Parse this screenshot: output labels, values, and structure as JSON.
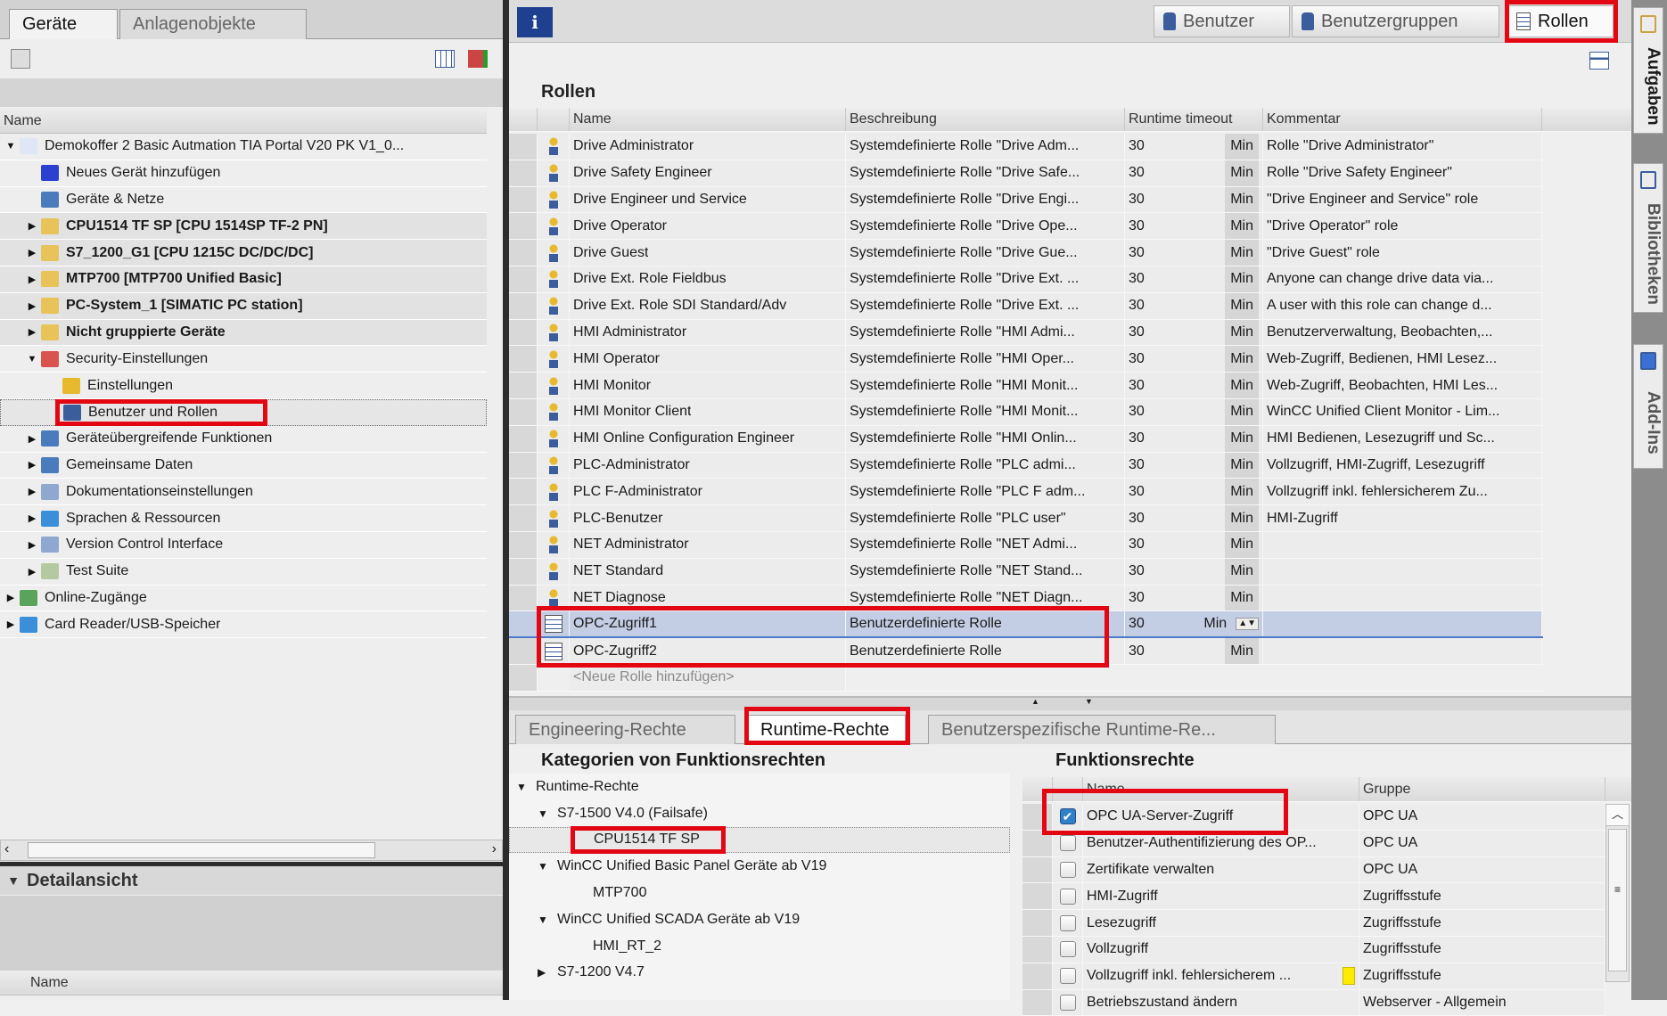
{
  "left": {
    "tabs": [
      "Geräte",
      "Anlagenobjekte"
    ],
    "column": "Name",
    "tree": [
      {
        "label": "Demokoffer 2 Basic Autmation TIA Portal V20 PK  V1_0...",
        "level": 0,
        "toggle": "down",
        "icon": "project-icon",
        "color": "#dfe6f5"
      },
      {
        "label": "Neues Gerät hinzufügen",
        "level": 1,
        "toggle": "",
        "icon": "add-device-icon",
        "color": "#2b3fd1"
      },
      {
        "label": "Geräte & Netze",
        "level": 1,
        "toggle": "",
        "icon": "network-icon",
        "color": "#4a7bbd"
      },
      {
        "label": "CPU1514 TF SP [CPU 1514SP TF-2 PN]",
        "level": 1,
        "toggle": "right",
        "icon": "plc-folder-icon",
        "color": "#e8c35a",
        "bold": true
      },
      {
        "label": "S7_1200_G1 [CPU 1215C DC/DC/DC]",
        "level": 1,
        "toggle": "right",
        "icon": "plc-folder-icon",
        "color": "#e8c35a",
        "bold": true
      },
      {
        "label": "MTP700 [MTP700 Unified Basic]",
        "level": 1,
        "toggle": "right",
        "icon": "hmi-folder-icon",
        "color": "#e8c35a",
        "bold": true
      },
      {
        "label": "PC-System_1 [SIMATIC PC station]",
        "level": 1,
        "toggle": "right",
        "icon": "pc-folder-icon",
        "color": "#e8c35a",
        "bold": true
      },
      {
        "label": "Nicht gruppierte Geräte",
        "level": 1,
        "toggle": "right",
        "icon": "ungrouped-folder-icon",
        "color": "#e8c35a",
        "bold": true
      },
      {
        "label": "Security-Einstellungen",
        "level": 1,
        "toggle": "down",
        "icon": "security-folder-icon",
        "color": "#d9534f"
      },
      {
        "label": "Einstellungen",
        "level": 2,
        "toggle": "",
        "icon": "settings-icon",
        "color": "#e7b92f"
      },
      {
        "label": "Benutzer und Rollen",
        "level": 2,
        "toggle": "",
        "icon": "users-icon",
        "color": "#3b5d9c",
        "selected": true
      },
      {
        "label": "Geräteübergreifende Funktionen",
        "level": 1,
        "toggle": "right",
        "icon": "cross-device-icon",
        "color": "#4a7bbd"
      },
      {
        "label": "Gemeinsame Daten",
        "level": 1,
        "toggle": "right",
        "icon": "common-data-icon",
        "color": "#4a7bbd"
      },
      {
        "label": "Dokumentationseinstellungen",
        "level": 1,
        "toggle": "right",
        "icon": "documentation-icon",
        "color": "#8fa8d0"
      },
      {
        "label": "Sprachen & Ressourcen",
        "level": 1,
        "toggle": "right",
        "icon": "languages-icon",
        "color": "#3a8fd8"
      },
      {
        "label": "Version Control Interface",
        "level": 1,
        "toggle": "right",
        "icon": "version-control-icon",
        "color": "#8fa8d0"
      },
      {
        "label": "Test Suite",
        "level": 1,
        "toggle": "right",
        "icon": "test-suite-icon",
        "color": "#b5c9a0"
      },
      {
        "label": "Online-Zugänge",
        "level": 0,
        "toggle": "right",
        "icon": "online-access-icon",
        "color": "#5aa35a"
      },
      {
        "label": "Card Reader/USB-Speicher",
        "level": 0,
        "toggle": "right",
        "icon": "card-reader-icon",
        "color": "#3a8fd8"
      }
    ],
    "detail_title": "Detailansicht",
    "detail_column": "Name"
  },
  "right": {
    "buttons": {
      "users": "Benutzer",
      "groups": "Benutzergruppen",
      "roles": "Rollen"
    },
    "title": "Rollen",
    "columns": [
      "Name",
      "Beschreibung",
      "Runtime timeout",
      "Kommentar"
    ],
    "roles": [
      {
        "name": "Drive Administrator",
        "desc": "Systemdefinierte Rolle \"Drive Adm...",
        "timeout": "30",
        "unit": "Min",
        "comment": "Rolle \"Drive Administrator\""
      },
      {
        "name": "Drive Safety Engineer",
        "desc": "Systemdefinierte Rolle \"Drive Safe...",
        "timeout": "30",
        "unit": "Min",
        "comment": "Rolle \"Drive Safety Engineer\""
      },
      {
        "name": "Drive Engineer und Service",
        "desc": "Systemdefinierte Rolle \"Drive Engi...",
        "timeout": "30",
        "unit": "Min",
        "comment": "\"Drive Engineer and Service\" role"
      },
      {
        "name": "Drive Operator",
        "desc": "Systemdefinierte Rolle \"Drive Ope...",
        "timeout": "30",
        "unit": "Min",
        "comment": "\"Drive Operator\" role"
      },
      {
        "name": "Drive Guest",
        "desc": "Systemdefinierte Rolle \"Drive Gue...",
        "timeout": "30",
        "unit": "Min",
        "comment": "\"Drive Guest\" role"
      },
      {
        "name": "Drive Ext. Role Fieldbus",
        "desc": "Systemdefinierte Rolle \"Drive Ext. ...",
        "timeout": "30",
        "unit": "Min",
        "comment": "Anyone can change drive data via..."
      },
      {
        "name": "Drive Ext. Role SDI Standard/Adv",
        "desc": "Systemdefinierte Rolle \"Drive Ext. ...",
        "timeout": "30",
        "unit": "Min",
        "comment": "A user with this role can change d..."
      },
      {
        "name": "HMI Administrator",
        "desc": "Systemdefinierte Rolle \"HMI Admi...",
        "timeout": "30",
        "unit": "Min",
        "comment": "Benutzerverwaltung, Beobachten,..."
      },
      {
        "name": "HMI Operator",
        "desc": "Systemdefinierte Rolle \"HMI Oper...",
        "timeout": "30",
        "unit": "Min",
        "comment": "Web-Zugriff, Bedienen, HMI Lesez..."
      },
      {
        "name": "HMI Monitor",
        "desc": "Systemdefinierte Rolle \"HMI Monit...",
        "timeout": "30",
        "unit": "Min",
        "comment": "Web-Zugriff, Beobachten, HMI Les..."
      },
      {
        "name": "HMI Monitor Client",
        "desc": "Systemdefinierte Rolle \"HMI Monit...",
        "timeout": "30",
        "unit": "Min",
        "comment": "WinCC Unified Client Monitor - Lim..."
      },
      {
        "name": "HMI Online Configuration Engineer",
        "desc": "Systemdefinierte Rolle \"HMI Onlin...",
        "timeout": "30",
        "unit": "Min",
        "comment": "HMI Bedienen, Lesezugriff und Sc..."
      },
      {
        "name": "PLC-Administrator",
        "desc": "Systemdefinierte Rolle \"PLC admi...",
        "timeout": "30",
        "unit": "Min",
        "comment": "Vollzugriff, HMI-Zugriff, Lesezugriff"
      },
      {
        "name": "PLC F-Administrator",
        "desc": "Systemdefinierte Rolle \"PLC F adm...",
        "timeout": "30",
        "unit": "Min",
        "comment": "Vollzugriff inkl. fehlersicherem Zu..."
      },
      {
        "name": "PLC-Benutzer",
        "desc": "Systemdefinierte Rolle \"PLC user\"",
        "timeout": "30",
        "unit": "Min",
        "comment": "HMI-Zugriff"
      },
      {
        "name": "NET Administrator",
        "desc": "Systemdefinierte Rolle \"NET Admi...",
        "timeout": "30",
        "unit": "Min",
        "comment": ""
      },
      {
        "name": "NET Standard",
        "desc": "Systemdefinierte Rolle \"NET Stand...",
        "timeout": "30",
        "unit": "Min",
        "comment": ""
      },
      {
        "name": "NET Diagnose",
        "desc": "Systemdefinierte Rolle \"NET Diagn...",
        "timeout": "30",
        "unit": "Min",
        "comment": ""
      },
      {
        "name": "OPC-Zugriff1",
        "desc": "Benutzerdefinierte Rolle",
        "timeout": "30",
        "unit": "Min",
        "comment": "",
        "custom": true,
        "selected": true
      },
      {
        "name": "OPC-Zugriff2",
        "desc": "Benutzerdefinierte Rolle",
        "timeout": "30",
        "unit": "Min",
        "comment": "",
        "custom": true
      }
    ],
    "new_role": "<Neue Rolle hinzufügen>",
    "tabs": [
      "Engineering-Rechte",
      "Runtime-Rechte",
      "Benutzerspezifische Runtime-Re..."
    ],
    "categories_title": "Kategorien von Funktionsrechten",
    "categories": [
      {
        "label": "Runtime-Rechte",
        "level": 0,
        "toggle": "down"
      },
      {
        "label": "S7-1500 V4.0 (Failsafe)",
        "level": 1,
        "toggle": "down"
      },
      {
        "label": "CPU1514 TF SP",
        "level": 2,
        "toggle": "",
        "selected": true
      },
      {
        "label": "WinCC Unified Basic Panel Geräte ab V19",
        "level": 1,
        "toggle": "down"
      },
      {
        "label": "MTP700",
        "level": 2,
        "toggle": ""
      },
      {
        "label": "WinCC Unified SCADA Geräte ab V19",
        "level": 1,
        "toggle": "down"
      },
      {
        "label": "HMI_RT_2",
        "level": 2,
        "toggle": ""
      },
      {
        "label": "S7-1200 V4.7",
        "level": 1,
        "toggle": "right"
      }
    ],
    "rights_title": "Funktionsrechte",
    "rights_columns": [
      "Name",
      "Gruppe"
    ],
    "rights": [
      {
        "name": "OPC UA-Server-Zugriff",
        "group": "OPC UA",
        "checked": true
      },
      {
        "name": "Benutzer-Authentifizierung des OP...",
        "group": "OPC UA",
        "checked": false
      },
      {
        "name": "Zertifikate verwalten",
        "group": "OPC UA",
        "checked": false
      },
      {
        "name": "HMI-Zugriff",
        "group": "Zugriffsstufe",
        "checked": false
      },
      {
        "name": "Lesezugriff",
        "group": "Zugriffsstufe",
        "checked": false
      },
      {
        "name": "Vollzugriff",
        "group": "Zugriffsstufe",
        "checked": false
      },
      {
        "name": "Vollzugriff inkl. fehlersicherem ...",
        "group": "Zugriffsstufe",
        "checked": false,
        "marker": true
      },
      {
        "name": "Betriebszustand ändern",
        "group": "Webserver - Allgemein",
        "checked": false
      }
    ]
  },
  "side": [
    "Aufgaben",
    "Bibliotheken",
    "Add-Ins"
  ],
  "colors": {
    "highlight": "#e30613",
    "selection": "#c3cde3",
    "accent": "#3b5d9c"
  }
}
